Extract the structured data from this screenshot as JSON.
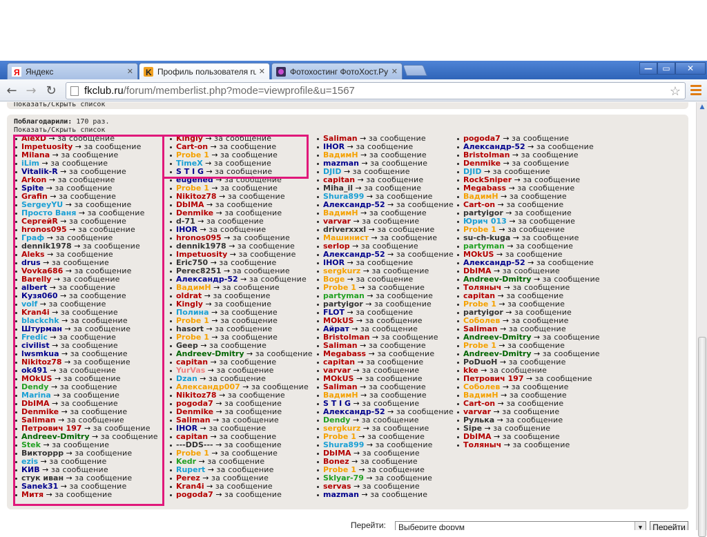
{
  "browser": {
    "tabs": [
      {
        "label": "Яндекс",
        "icon": "yandex-icon",
        "active": false
      },
      {
        "label": "Профиль пользователя rus",
        "icon": "fkclub-icon",
        "active": true
      },
      {
        "label": "Фотохостинг ФотоХост.Ру",
        "icon": "fotohost-icon",
        "active": false
      }
    ],
    "url_domain": "fkclub.ru",
    "url_path": "/forum/memberlist.php?mode=viewprofile&u=1567",
    "window_controls": {
      "minimize": "—",
      "maximize": "▭",
      "close": "✕"
    }
  },
  "page": {
    "toggle_label": "Показать/Скрыть список",
    "thanked_label": "Поблагодарили:",
    "thanked_count": "170 раз.",
    "jump_label": "Перейти:",
    "jump_placeholder": "Выберите форум",
    "jump_button": "Перейти",
    "suffix": "за сообщение"
  },
  "colors": {
    "highlight": "#e0187a",
    "panel": "#ece9e5",
    "red": "#b30000",
    "darkred": "#8b0000",
    "navy": "#00008b",
    "green": "#006400",
    "cyan": "#1a9fd4",
    "orange": "#f5a100",
    "gray": "#333333",
    "pink": "#f08080",
    "purple": "#8a2be2"
  },
  "columns": [
    [
      {
        "name": "AlexD",
        "color": "#b30000"
      },
      {
        "name": "Impetuosity",
        "color": "#b30000"
      },
      {
        "name": "Milana",
        "color": "#b30000"
      },
      {
        "name": "iLim",
        "color": "#1a9fd4"
      },
      {
        "name": "Vitalik-R",
        "color": "#00008b"
      },
      {
        "name": "Arkon",
        "color": "#b30000"
      },
      {
        "name": "Spite",
        "color": "#00008b"
      },
      {
        "name": "Grafin",
        "color": "#b30000"
      },
      {
        "name": "SergeyYU",
        "color": "#1a9fd4"
      },
      {
        "name": "Просто Ваня",
        "color": "#1a9fd4"
      },
      {
        "name": "СергейR",
        "color": "#b30000"
      },
      {
        "name": "hronos095",
        "color": "#b30000"
      },
      {
        "name": "Граф",
        "color": "#1a9fd4"
      },
      {
        "name": "dennik1978",
        "color": "#333333"
      },
      {
        "name": "Aleks",
        "color": "#b30000"
      },
      {
        "name": "drus",
        "color": "#00008b"
      },
      {
        "name": "Vovka686",
        "color": "#b30000"
      },
      {
        "name": "Barelly",
        "color": "#b30000"
      },
      {
        "name": "albert",
        "color": "#00008b"
      },
      {
        "name": "Кузя060",
        "color": "#00008b"
      },
      {
        "name": "volf",
        "color": "#1a9fd4"
      },
      {
        "name": "Kran4i",
        "color": "#b30000"
      },
      {
        "name": "blackchk",
        "color": "#1a9fd4"
      },
      {
        "name": "Штурман",
        "color": "#00008b"
      },
      {
        "name": "Fredic",
        "color": "#1a9fd4"
      },
      {
        "name": "civilist",
        "color": "#00008b"
      },
      {
        "name": "lwsmkua",
        "color": "#00008b"
      },
      {
        "name": "Nikitoz78",
        "color": "#b30000"
      },
      {
        "name": "ok491",
        "color": "#00008b"
      },
      {
        "name": "MOkUS",
        "color": "#b30000"
      },
      {
        "name": "Dendy",
        "color": "#22a022"
      },
      {
        "name": "Marina",
        "color": "#1a9fd4"
      },
      {
        "name": "DbIMA",
        "color": "#b30000"
      },
      {
        "name": "Denmike",
        "color": "#b30000"
      },
      {
        "name": "Saliman",
        "color": "#b30000"
      },
      {
        "name": "Петрович 197",
        "color": "#b30000"
      },
      {
        "name": "Andreev-Dmitry",
        "color": "#006400"
      },
      {
        "name": "Stek",
        "color": "#22a022"
      },
      {
        "name": "Викторрр",
        "color": "#333333"
      },
      {
        "name": "ezis",
        "color": "#1a9fd4"
      },
      {
        "name": "КИВ",
        "color": "#00008b"
      },
      {
        "name": "стук иван",
        "color": "#333333"
      },
      {
        "name": "Sanek31",
        "color": "#00008b"
      },
      {
        "name": "Митя",
        "color": "#b30000"
      }
    ],
    [
      {
        "name": "Kingly",
        "color": "#b30000"
      },
      {
        "name": "Cart-on",
        "color": "#b30000"
      },
      {
        "name": "Probe 1",
        "color": "#f5a100"
      },
      {
        "name": "TimeX",
        "color": "#1a9fd4"
      },
      {
        "name": "S T I G",
        "color": "#00008b"
      },
      {
        "name": "eugened",
        "color": "#00008b"
      },
      {
        "name": "Probe 1",
        "color": "#f5a100"
      },
      {
        "name": "Nikitoz78",
        "color": "#b30000"
      },
      {
        "name": "DbIMA",
        "color": "#b30000"
      },
      {
        "name": "Denmike",
        "color": "#b30000"
      },
      {
        "name": "d-71",
        "color": "#333333"
      },
      {
        "name": "IHOR",
        "color": "#00008b"
      },
      {
        "name": "hronos095",
        "color": "#b30000"
      },
      {
        "name": "dennik1978",
        "color": "#333333"
      },
      {
        "name": "Impetuosity",
        "color": "#b30000"
      },
      {
        "name": "Eric750",
        "color": "#333333"
      },
      {
        "name": "Perec8251",
        "color": "#333333"
      },
      {
        "name": "Александр-52",
        "color": "#00008b"
      },
      {
        "name": "ВадимН",
        "color": "#f5a100"
      },
      {
        "name": "oldrat",
        "color": "#b30000"
      },
      {
        "name": "Kingly",
        "color": "#b30000"
      },
      {
        "name": "Полина",
        "color": "#1a9fd4"
      },
      {
        "name": "Probe 1",
        "color": "#f5a100"
      },
      {
        "name": "hasort",
        "color": "#333333"
      },
      {
        "name": "Probe 1",
        "color": "#f5a100"
      },
      {
        "name": "Geep",
        "color": "#333333"
      },
      {
        "name": "Andreev-Dmitry",
        "color": "#006400"
      },
      {
        "name": "capitan",
        "color": "#b30000"
      },
      {
        "name": "YurVas",
        "color": "#f08080"
      },
      {
        "name": "Dzan",
        "color": "#1a9fd4"
      },
      {
        "name": "Александр007",
        "color": "#f5a100"
      },
      {
        "name": "Nikitoz78",
        "color": "#b30000"
      },
      {
        "name": "pogoda7",
        "color": "#b30000"
      },
      {
        "name": "Denmike",
        "color": "#b30000"
      },
      {
        "name": "Saliman",
        "color": "#b30000"
      },
      {
        "name": "IHOR",
        "color": "#00008b"
      },
      {
        "name": "capitan",
        "color": "#b30000"
      },
      {
        "name": "---DDS---",
        "color": "#333333"
      },
      {
        "name": "Probe 1",
        "color": "#f5a100"
      },
      {
        "name": "Kedr",
        "color": "#22a022"
      },
      {
        "name": "Rupert",
        "color": "#1a9fd4"
      },
      {
        "name": "Perez",
        "color": "#b30000"
      },
      {
        "name": "Kran4i",
        "color": "#b30000"
      },
      {
        "name": "pogoda7",
        "color": "#b30000"
      }
    ],
    [
      {
        "name": "Saliman",
        "color": "#b30000"
      },
      {
        "name": "IHOR",
        "color": "#00008b"
      },
      {
        "name": "ВадимН",
        "color": "#f5a100"
      },
      {
        "name": "mazman",
        "color": "#00008b"
      },
      {
        "name": "DJID",
        "color": "#1a9fd4"
      },
      {
        "name": "capitan",
        "color": "#b30000"
      },
      {
        "name": "Miha_il",
        "color": "#333333"
      },
      {
        "name": "Shura899",
        "color": "#1a9fd4"
      },
      {
        "name": "Александр-52",
        "color": "#00008b"
      },
      {
        "name": "ВадимН",
        "color": "#f5a100"
      },
      {
        "name": "varvar",
        "color": "#b30000"
      },
      {
        "name": "driverxxxl",
        "color": "#333333"
      },
      {
        "name": "Машинист",
        "color": "#f5a100"
      },
      {
        "name": "serlop",
        "color": "#b30000"
      },
      {
        "name": "Александр-52",
        "color": "#00008b"
      },
      {
        "name": "IHOR",
        "color": "#00008b"
      },
      {
        "name": "sergkurz",
        "color": "#f5a100"
      },
      {
        "name": "Boge",
        "color": "#f5a100"
      },
      {
        "name": "Probe 1",
        "color": "#f5a100"
      },
      {
        "name": "partyman",
        "color": "#22a022"
      },
      {
        "name": "partyigor",
        "color": "#333333"
      },
      {
        "name": "FLOT",
        "color": "#00008b"
      },
      {
        "name": "MOkUS",
        "color": "#b30000"
      },
      {
        "name": "Айрат",
        "color": "#00008b"
      },
      {
        "name": "Bristolman",
        "color": "#b30000"
      },
      {
        "name": "Saliman",
        "color": "#b30000"
      },
      {
        "name": "Megabass",
        "color": "#b30000"
      },
      {
        "name": "capitan",
        "color": "#b30000"
      },
      {
        "name": "varvar",
        "color": "#b30000"
      },
      {
        "name": "MOkUS",
        "color": "#b30000"
      },
      {
        "name": "Saliman",
        "color": "#b30000"
      },
      {
        "name": "ВадимН",
        "color": "#f5a100"
      },
      {
        "name": "S T I G",
        "color": "#00008b"
      },
      {
        "name": "Александр-52",
        "color": "#00008b"
      },
      {
        "name": "Dendy",
        "color": "#22a022"
      },
      {
        "name": "sergkurz",
        "color": "#f5a100"
      },
      {
        "name": "Probe 1",
        "color": "#f5a100"
      },
      {
        "name": "Shura899",
        "color": "#1a9fd4"
      },
      {
        "name": "DbIMA",
        "color": "#b30000"
      },
      {
        "name": "Bonez",
        "color": "#b30000"
      },
      {
        "name": "Probe 1",
        "color": "#f5a100"
      },
      {
        "name": "Sklyar-79",
        "color": "#22a022"
      },
      {
        "name": "servas",
        "color": "#b30000"
      },
      {
        "name": "mazman",
        "color": "#00008b"
      }
    ],
    [
      {
        "name": "pogoda7",
        "color": "#b30000"
      },
      {
        "name": "Александр-52",
        "color": "#00008b"
      },
      {
        "name": "Bristolman",
        "color": "#b30000"
      },
      {
        "name": "Denmike",
        "color": "#b30000"
      },
      {
        "name": "DJID",
        "color": "#1a9fd4"
      },
      {
        "name": "RockSniper",
        "color": "#b30000"
      },
      {
        "name": "Megabass",
        "color": "#b30000"
      },
      {
        "name": "ВадимН",
        "color": "#f5a100"
      },
      {
        "name": "Cart-on",
        "color": "#b30000"
      },
      {
        "name": "partyigor",
        "color": "#333333"
      },
      {
        "name": "Юрич 013",
        "color": "#1a9fd4"
      },
      {
        "name": "Probe 1",
        "color": "#f5a100"
      },
      {
        "name": "su-ch-kuga",
        "color": "#333333"
      },
      {
        "name": "partyman",
        "color": "#22a022"
      },
      {
        "name": "MOkUS",
        "color": "#b30000"
      },
      {
        "name": "Александр-52",
        "color": "#00008b"
      },
      {
        "name": "DbIMA",
        "color": "#b30000"
      },
      {
        "name": "Andreev-Dmitry",
        "color": "#006400"
      },
      {
        "name": "Толяныч",
        "color": "#b30000"
      },
      {
        "name": "capitan",
        "color": "#b30000"
      },
      {
        "name": "Probe 1",
        "color": "#f5a100"
      },
      {
        "name": "partyigor",
        "color": "#333333"
      },
      {
        "name": "Соболев",
        "color": "#f5a100"
      },
      {
        "name": "Saliman",
        "color": "#b30000"
      },
      {
        "name": "Andreev-Dmitry",
        "color": "#006400"
      },
      {
        "name": "Probe 1",
        "color": "#f5a100"
      },
      {
        "name": "Andreev-Dmitry",
        "color": "#006400"
      },
      {
        "name": "PoDuoH",
        "color": "#333333"
      },
      {
        "name": "kke",
        "color": "#b30000"
      },
      {
        "name": "Петрович 197",
        "color": "#b30000"
      },
      {
        "name": "Соболев",
        "color": "#f5a100"
      },
      {
        "name": "ВадимН",
        "color": "#f5a100"
      },
      {
        "name": "Cart-on",
        "color": "#b30000"
      },
      {
        "name": "varvar",
        "color": "#b30000"
      },
      {
        "name": "Рулька",
        "color": "#333333"
      },
      {
        "name": "Sipe",
        "color": "#333333"
      },
      {
        "name": "DbIMA",
        "color": "#b30000"
      },
      {
        "name": "Толяныч",
        "color": "#b30000"
      }
    ]
  ]
}
